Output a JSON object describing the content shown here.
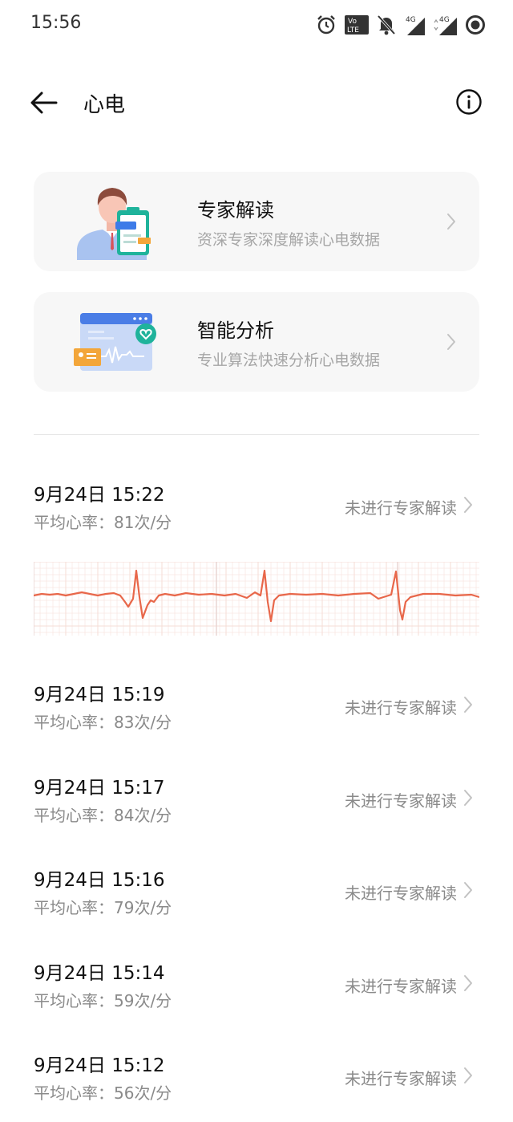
{
  "status_bar": {
    "time": "15:56",
    "icons": [
      "alarm-icon",
      "volte-icon",
      "bell-off-icon",
      "signal-4g-icon",
      "signal-4g-icon",
      "ring-icon"
    ],
    "volte_top": "Vo",
    "volte_bottom": "LTE",
    "network_label": "4G"
  },
  "header": {
    "title": "心电",
    "back_icon": "back-arrow-icon",
    "info_icon": "info-icon"
  },
  "cards": [
    {
      "title": "专家解读",
      "subtitle": "资深专家深度解读心电数据",
      "icon": "doctor-clipboard-illustration"
    },
    {
      "title": "智能分析",
      "subtitle": "专业算法快速分析心电数据",
      "icon": "smart-analysis-illustration"
    }
  ],
  "records": [
    {
      "date": "9月24日 15:22",
      "heart_rate": "平均心率：81次/分",
      "status": "未进行专家解读",
      "has_ecg": true
    },
    {
      "date": "9月24日 15:19",
      "heart_rate": "平均心率：83次/分",
      "status": "未进行专家解读"
    },
    {
      "date": "9月24日 15:17",
      "heart_rate": "平均心率：84次/分",
      "status": "未进行专家解读"
    },
    {
      "date": "9月24日 15:16",
      "heart_rate": "平均心率：79次/分",
      "status": "未进行专家解读"
    },
    {
      "date": "9月24日 15:14",
      "heart_rate": "平均心率：59次/分",
      "status": "未进行专家解读"
    },
    {
      "date": "9月24日 15:12",
      "heart_rate": "平均心率：56次/分",
      "status": "未进行专家解读"
    }
  ],
  "colors": {
    "ecg_line": "#e8674a",
    "ecg_grid": "#f6dcd6",
    "card_bg": "#f7f7f7"
  }
}
